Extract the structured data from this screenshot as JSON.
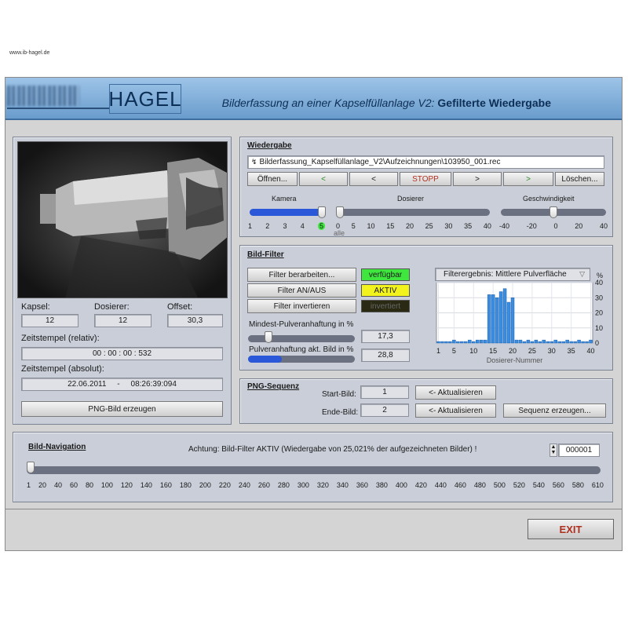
{
  "header": {
    "brand": "HAGEL",
    "title_prefix": "Bilderfassung an einer Kapselfüllanlage V2:",
    "title_bold": "Gefilterte Wiedergabe",
    "url": "www.ib-hagel.de"
  },
  "left": {
    "kapsel_label": "Kapsel:",
    "kapsel_value": "12",
    "dosierer_label": "Dosierer:",
    "dosierer_value": "12",
    "offset_label": "Offset:",
    "offset_value": "30,3",
    "ts_rel_label": "Zeitstempel (relativ):",
    "ts_rel_value": "00 : 00 : 00 : 532",
    "ts_abs_label": "Zeitstempel (absolut):",
    "ts_abs_value": "22.06.2011     -     08:26:39:094",
    "png_button": "PNG-Bild erzeugen"
  },
  "wiedergabe": {
    "title": "Wiedergabe",
    "path": "Bilderfassung_Kapselfüllanlage_V2\\Aufzeichnungen\\103950_001.rec",
    "buttons": {
      "open": "Öffnen...",
      "first": "<",
      "prev": "<",
      "stop": "STOPP",
      "next": ">",
      "last": ">",
      "delete": "Löschen..."
    },
    "kamera_label": "Kamera",
    "kamera_ticks": [
      "1",
      "2",
      "3",
      "4",
      "5"
    ],
    "kamera_value": 5,
    "dosierer_label": "Dosierer",
    "dosierer_ticks": [
      "0",
      "5",
      "10",
      "15",
      "20",
      "25",
      "30",
      "35",
      "40"
    ],
    "dosierer_value": 0,
    "dosierer_extra": "alle",
    "speed_label": "Geschwindigkeit",
    "speed_ticks": [
      "-40",
      "-20",
      "0",
      "20",
      "40"
    ],
    "speed_value": 0
  },
  "filter": {
    "title": "Bild-Filter",
    "btn_edit": "Filter berarbeiten...",
    "btn_toggle": "Filter AN/AUS",
    "btn_invert": "Filter invertieren",
    "ind_available": "verfügbar",
    "ind_active": "AKTIV",
    "ind_inverted": "invertiert",
    "min_label": "Mindest-Pulveranhaftung in %",
    "min_value": "17,3",
    "min_fraction": 0.173,
    "cur_label": "Pulveranhaftung akt. Bild in %",
    "cur_value": "28,8",
    "cur_fraction": 0.288,
    "result_select": "Filterergebnis: Mittlere Pulverfläche",
    "colors": {
      "available": "#3ee63e",
      "active": "#f2f21c",
      "inverted": "#2a2a14"
    }
  },
  "chart_data": {
    "type": "bar",
    "title": "",
    "xlabel": "Dosierer-Nummer",
    "ylabel": "%",
    "xlim": [
      1,
      40
    ],
    "ylim": [
      0,
      40
    ],
    "x_ticks": [
      "1",
      "5",
      "10",
      "15",
      "20",
      "25",
      "30",
      "35",
      "40"
    ],
    "y_ticks": [
      "0",
      "10",
      "20",
      "30",
      "40"
    ],
    "categories": [
      1,
      2,
      3,
      4,
      5,
      6,
      7,
      8,
      9,
      10,
      11,
      12,
      13,
      14,
      15,
      16,
      17,
      18,
      19,
      20,
      21,
      22,
      23,
      24,
      25,
      26,
      27,
      28,
      29,
      30,
      31,
      32,
      33,
      34,
      35,
      36,
      37,
      38,
      39,
      40
    ],
    "values": [
      1,
      1,
      1,
      1,
      2,
      1,
      1,
      1,
      2,
      1,
      2,
      2,
      2,
      32,
      32,
      30,
      34,
      36,
      27,
      30,
      2,
      2,
      1,
      2,
      1,
      2,
      1,
      2,
      1,
      1,
      2,
      1,
      1,
      2,
      1,
      1,
      2,
      1,
      1,
      2
    ],
    "bar_color": "#3a8de0",
    "grid": true
  },
  "png": {
    "title": "PNG-Sequenz",
    "start_label": "Start-Bild:",
    "start_value": "1",
    "end_label": "Ende-Bild:",
    "end_value": "2",
    "refresh_start": "<- Aktualisieren",
    "refresh_end": "<- Aktualisieren",
    "create_button": "Sequenz erzeugen..."
  },
  "nav": {
    "title": "Bild-Navigation",
    "warning": "Achtung: Bild-Filter AKTIV (Wiedergabe von 25,021% der aufgezeichneten Bilder) !",
    "counter": "000001",
    "value": 1,
    "ticks": [
      "1",
      "20",
      "40",
      "60",
      "80",
      "100",
      "120",
      "140",
      "160",
      "180",
      "200",
      "220",
      "240",
      "260",
      "280",
      "300",
      "320",
      "340",
      "360",
      "380",
      "400",
      "420",
      "440",
      "460",
      "480",
      "500",
      "520",
      "540",
      "560",
      "580",
      "610"
    ]
  },
  "exit_label": "EXIT"
}
